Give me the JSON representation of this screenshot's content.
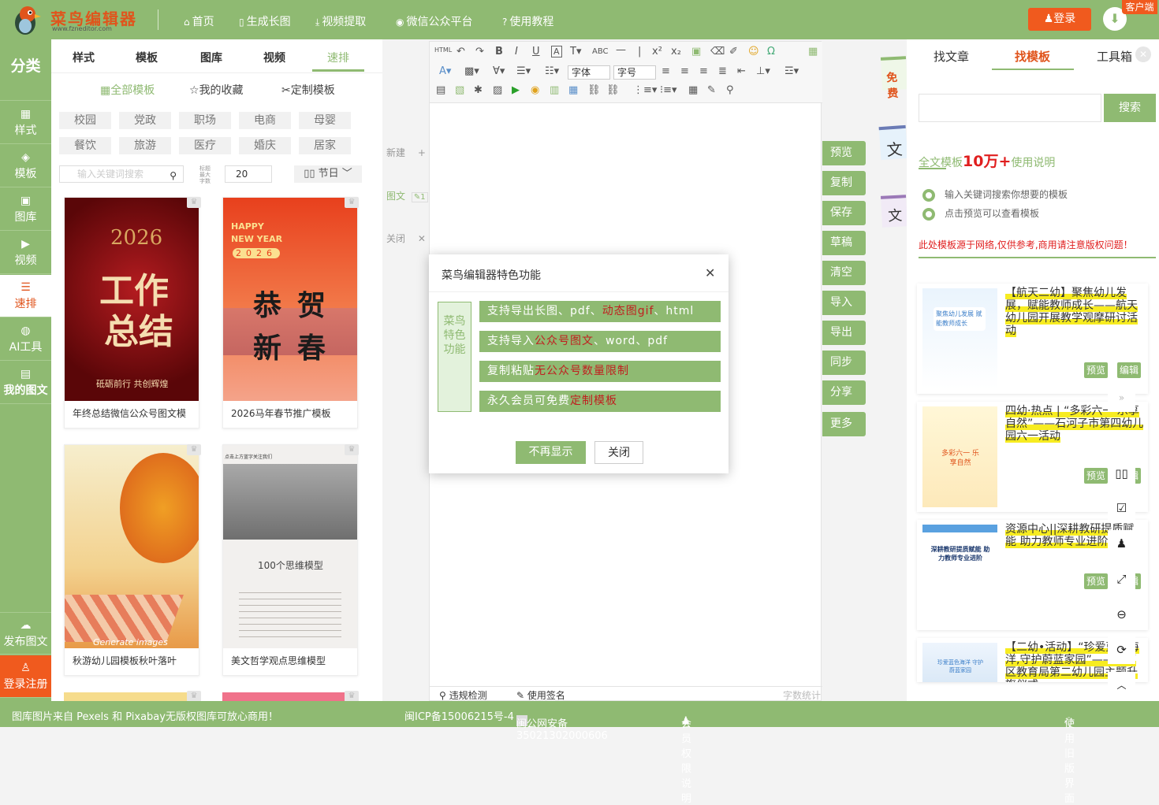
{
  "header": {
    "logo_cn": "菜鸟编辑器",
    "logo_en": "www.fzneditor.com",
    "nav": [
      {
        "icon": "home-icon",
        "label": "首页"
      },
      {
        "icon": "file-icon",
        "label": "生成长图"
      },
      {
        "icon": "download-icon",
        "label": "视频提取"
      },
      {
        "icon": "wechat-icon",
        "label": "微信公众平台"
      },
      {
        "icon": "help-icon",
        "label": "使用教程"
      }
    ],
    "login": "登录",
    "service": "客户端"
  },
  "sidebar": {
    "head": "分类",
    "items": [
      "样式",
      "模板",
      "图库",
      "视频",
      "速排",
      "AI工具",
      "我的图文",
      "发布图文",
      "登录注册"
    ]
  },
  "panel": {
    "tabs": [
      "样式",
      "模板",
      "图库",
      "视频",
      "速排"
    ],
    "subtabs": [
      "全部模板",
      "我的收藏",
      "定制模板"
    ],
    "categories": [
      "校园",
      "党政",
      "职场",
      "电商",
      "母婴",
      "餐饮",
      "旅游",
      "医疗",
      "婚庆",
      "居家"
    ],
    "search_placeholder": "输入关键词搜索",
    "mini_label": "标题最大字数",
    "max_chars": "20",
    "festival": "节日",
    "cards": [
      {
        "caption": "年终总结微信公众号图文模",
        "img_year": "2026",
        "img_text1": "工作",
        "img_text2": "总结",
        "img_sub": "砥砺前行 共创辉煌"
      },
      {
        "caption": "2026马年春节推广模板",
        "img_en1": "HAPPY",
        "img_en2": "NEW YEAR",
        "img_digits": "2026",
        "img_text1": "恭贺",
        "img_text2": "新春"
      },
      {
        "caption": "秋游幼儿园模板秋叶落叶",
        "img_sub": "Generate images"
      },
      {
        "caption": "美文哲学观点思维模型",
        "img_top": "点击上方蓝字关注我们",
        "img_title": "100个思维模型"
      }
    ]
  },
  "editor": {
    "fonts": {
      "family": "字体",
      "size": "字号"
    },
    "side": [
      "新建",
      "图文",
      "关闭"
    ],
    "footer": {
      "check": "违规检测",
      "sign": "使用签名",
      "count": "字数统计"
    }
  },
  "actions": [
    "预览",
    "复制",
    "保存",
    "草稿",
    "清空",
    "导入",
    "导出",
    "同步",
    "分享",
    "更多"
  ],
  "floating": {
    "free": "免费",
    "text": "文"
  },
  "right": {
    "tabs": [
      "找文章",
      "找模板",
      "工具箱"
    ],
    "search_btn": "搜索",
    "promo": {
      "pre": "全文模板",
      "num": "10万+",
      "post": "使用说明"
    },
    "tips": [
      "输入关键词搜索你想要的模板",
      "点击预览可以查看模板"
    ],
    "warning": "此处模板源于网络,仅供参考,商用请注意版权问题！",
    "cards": [
      {
        "title": "【航天二幼】聚焦幼儿发展，赋能教师成长——航天幼儿园开展教学观摩研讨活动",
        "thumb_text": "聚焦幼儿发展 赋能教师成长",
        "preview": "预览",
        "edit": "编辑"
      },
      {
        "title": "四幼·热点 | “多彩六一 乐享自然”——石河子市第四幼儿园六一活动",
        "thumb_text": "多彩六一 乐享自然",
        "preview": "预览",
        "edit": "编辑"
      },
      {
        "title": "资源中心||深耕教研提质赋能 助力教师专业进阶",
        "thumb_text": "深耕教研提质赋能 助力教师专业进阶",
        "preview": "预览",
        "edit": "编辑"
      },
      {
        "title": "【二幼•活动】“珍爱蓝色海洋,守护蔚蓝家园”——沈河区教育局第二幼儿园主题升旗仪式",
        "thumb_text": "珍爱蓝色海洋 守护蔚蓝家园"
      }
    ]
  },
  "dialog": {
    "title": "菜鸟编辑器特色功能",
    "side": "菜鸟特色功能",
    "features": [
      {
        "a": "支持导出长图、pdf、",
        "b": "动态图gif",
        "c": "、html"
      },
      {
        "a": "支持导入",
        "b": "公众号图文",
        "c": "、word、pdf"
      },
      {
        "a": "复制粘贴",
        "b": "无公众号数量限制",
        "c": ""
      },
      {
        "a": "永久会员可免费",
        "b": "定制模板",
        "c": ""
      }
    ],
    "btn_no": "不再显示",
    "btn_close": "关闭"
  },
  "footer": {
    "left": "图库图片来自 Pexels 和 Pixabay无版权图库可放心商用！",
    "icp": "闽ICP备15006215号-4",
    "police": "闽公网安备35021302000606",
    "vip": "会员权限说明",
    "old": "使用旧版界面"
  },
  "colors": {
    "green": "#8fba72",
    "orange": "#f05a1e",
    "red": "#e0541c"
  }
}
